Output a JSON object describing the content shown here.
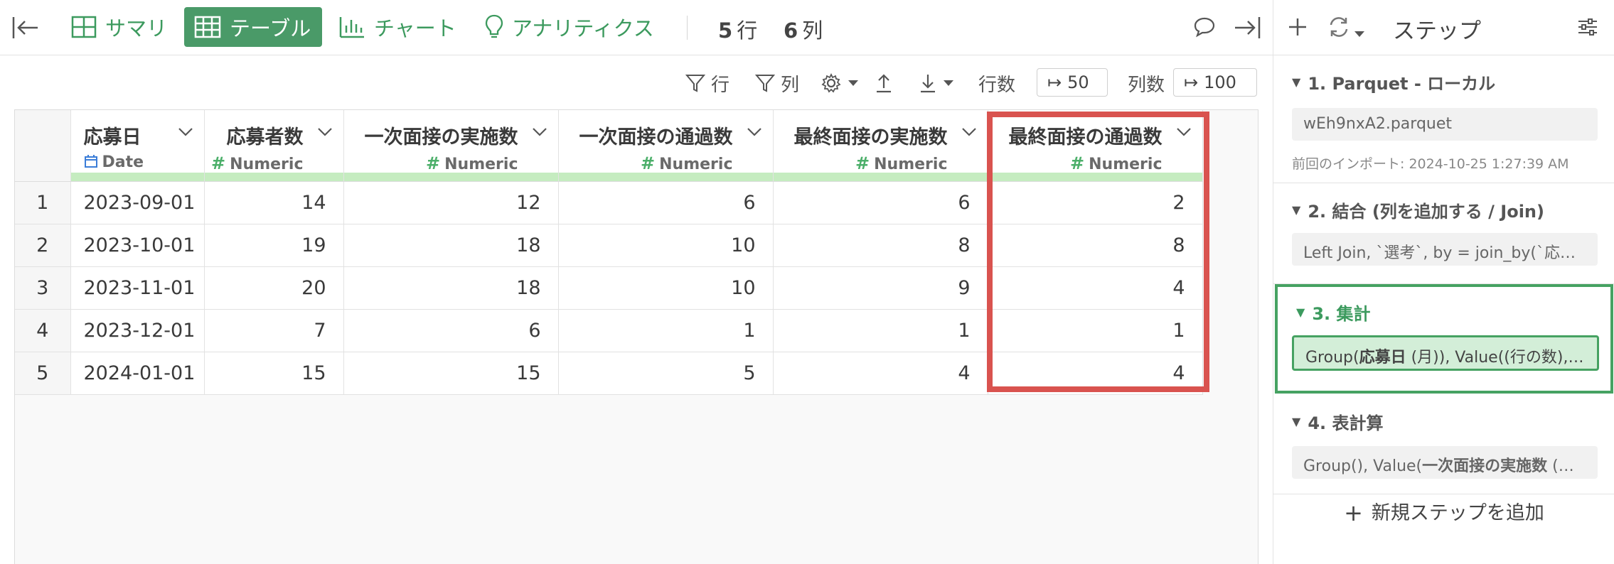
{
  "toolbar": {
    "tabs": [
      {
        "label": "サマリ",
        "icon": "grid-icon",
        "active": false
      },
      {
        "label": "テーブル",
        "icon": "table-icon",
        "active": true
      },
      {
        "label": "チャート",
        "icon": "bar-chart-icon",
        "active": false
      },
      {
        "label": "アナリティクス",
        "icon": "lightbulb-icon",
        "active": false
      }
    ],
    "rows_count": "5",
    "rows_unit": "行",
    "cols_count": "6",
    "cols_unit": "列"
  },
  "subtoolbar": {
    "row_filter_label": "行",
    "col_filter_label": "列",
    "rows_limit_label": "行数",
    "rows_limit_value": "50",
    "cols_limit_label": "列数",
    "cols_limit_value": "100"
  },
  "table": {
    "columns": [
      {
        "name": "応募日",
        "type": "Date"
      },
      {
        "name": "応募者数",
        "type": "Numeric"
      },
      {
        "name": "一次面接の実施数",
        "type": "Numeric"
      },
      {
        "name": "一次面接の通過数",
        "type": "Numeric"
      },
      {
        "name": "最終面接の実施数",
        "type": "Numeric"
      },
      {
        "name": "最終面接の通過数",
        "type": "Numeric"
      }
    ],
    "rows": [
      [
        "1",
        "2023-09-01",
        "14",
        "12",
        "6",
        "6",
        "2"
      ],
      [
        "2",
        "2023-10-01",
        "19",
        "18",
        "10",
        "8",
        "8"
      ],
      [
        "3",
        "2023-11-01",
        "20",
        "18",
        "10",
        "9",
        "4"
      ],
      [
        "4",
        "2023-12-01",
        "7",
        "6",
        "1",
        "1",
        "1"
      ],
      [
        "5",
        "2024-01-01",
        "15",
        "15",
        "5",
        "4",
        "4"
      ]
    ],
    "highlighted_column": "最終面接の通過数"
  },
  "panel": {
    "title": "ステップ",
    "steps": [
      {
        "title": "1. Parquet - ローカル",
        "detail": "wEh9nxA2.parquet",
        "sub": "前回のインポート: 2024-10-25 1:27:39 AM"
      },
      {
        "title": "2. 結合 (列を追加する / Join)",
        "detail": "Left Join, `選考`, by = join_by(`応募日`"
      },
      {
        "title": "3. 集計",
        "detail_pre": "Group(",
        "detail_bold": "応募日",
        "detail_post": " (月)), Value((行の数),(応募者数"
      },
      {
        "title": "4. 表計算",
        "detail_pre": "Group(), Value(",
        "detail_bold": "一次面接の実施数",
        "detail_post": " (累積合計"
      }
    ],
    "add_step_label": "新規ステップを追加"
  },
  "colors": {
    "accent": "#4a9a68",
    "highlight_border": "#d9534f",
    "type_strip": "#c5ecc0"
  }
}
